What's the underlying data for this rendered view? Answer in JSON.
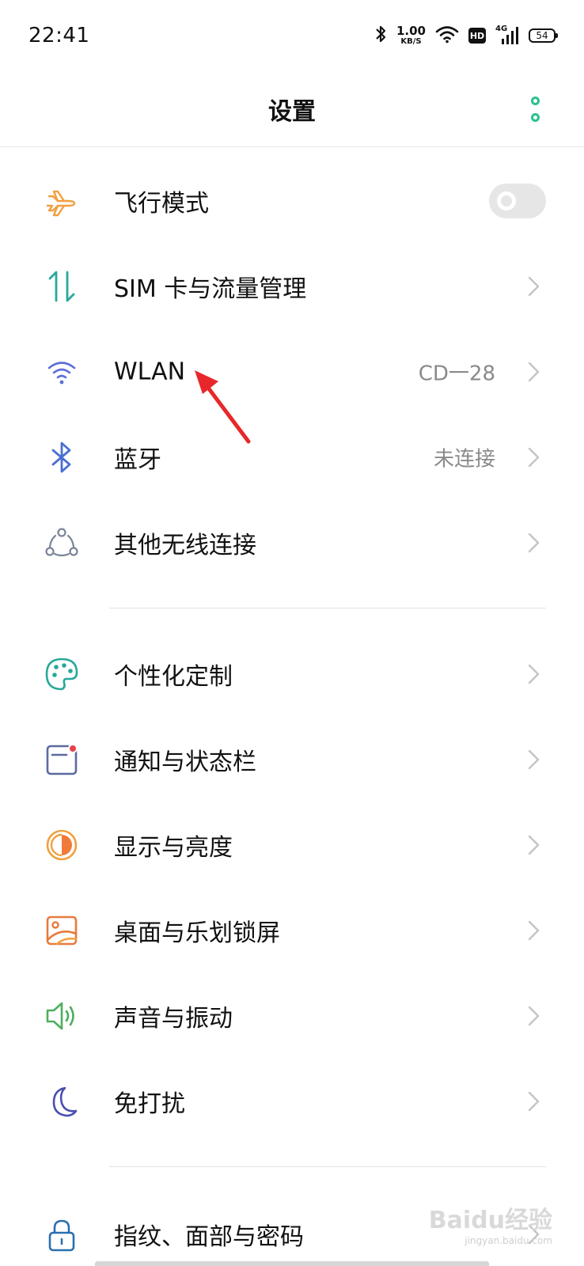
{
  "status_bar": {
    "time": "22:41",
    "net_speed_value": "1.00",
    "net_speed_unit": "KB/S",
    "hd_label": "HD",
    "signal_label": "4G",
    "battery": "54"
  },
  "header": {
    "title": "设置"
  },
  "rows": [
    {
      "label": "飞行模式",
      "icon": "airplane-icon",
      "toggle_on": false
    },
    {
      "label": "SIM 卡与流量管理",
      "icon": "sim-data-icon"
    },
    {
      "label": "WLAN",
      "value": "CD一28",
      "icon": "wifi-icon"
    },
    {
      "label": "蓝牙",
      "value": "未连接",
      "icon": "bluetooth-icon"
    },
    {
      "label": "其他无线连接",
      "icon": "wireless-connections-icon"
    },
    {
      "label": "个性化定制",
      "icon": "palette-icon"
    },
    {
      "label": "通知与状态栏",
      "icon": "notification-icon"
    },
    {
      "label": "显示与亮度",
      "icon": "brightness-icon"
    },
    {
      "label": "桌面与乐划锁屏",
      "icon": "wallpaper-icon"
    },
    {
      "label": "声音与振动",
      "icon": "speaker-icon"
    },
    {
      "label": "免打扰",
      "icon": "moon-icon"
    },
    {
      "label": "指纹、面部与密码",
      "icon": "lock-icon"
    }
  ],
  "colors": {
    "accent": "#2bc08f",
    "airplane": "#f0a040",
    "sim": "#2aa89a",
    "wifi": "#5b6fd6",
    "bluetooth": "#4a6fd1",
    "palette": "#27a899",
    "notification": "#5a6b9e",
    "notification_dot": "#e6424b",
    "brightness": "#f07a3a",
    "wallpaper": "#e77a3f",
    "speaker": "#4caf5d",
    "moon": "#4b4fb0",
    "arrow": "#e8272a"
  },
  "watermark": {
    "brand": "Baidu经验",
    "url": "jingyan.baidu.com"
  }
}
